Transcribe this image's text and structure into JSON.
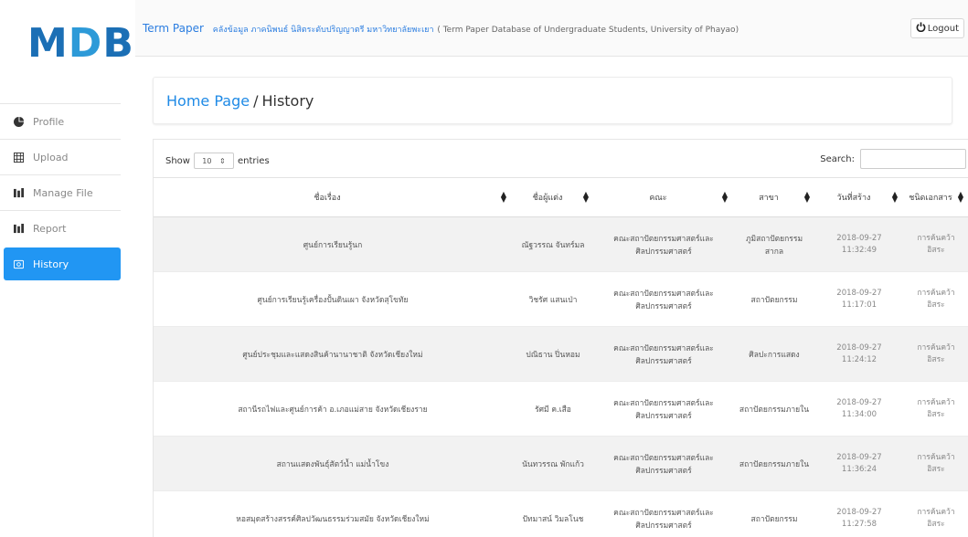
{
  "logo": {
    "left": "M",
    "mid": "D",
    "right": "B"
  },
  "sidebar": {
    "items": [
      {
        "label": "Profile",
        "icon": "pie-chart-icon"
      },
      {
        "label": "Upload",
        "icon": "table-icon"
      },
      {
        "label": "Manage File",
        "icon": "bars-icon"
      },
      {
        "label": "Report",
        "icon": "bars-icon"
      },
      {
        "label": "History",
        "icon": "history-icon"
      }
    ]
  },
  "topbar": {
    "brand": "Term Paper",
    "thai_title": "คลังข้อมูล ภาคนิพนธ์ นิสิตระดับปริญญาตรี มหาวิทยาลัยพะเยา",
    "eng_title": "( Term Paper Database of Undergraduate Students, University of Phayao)",
    "logout_label": "Logout"
  },
  "breadcrumb": {
    "home": "Home Page",
    "separator": "/",
    "current": "History"
  },
  "table_controls": {
    "show_label": "Show",
    "entries_value": "10",
    "entries_label": "entries",
    "search_label": "Search:"
  },
  "table": {
    "headers": [
      "ชื่อเรื่อง",
      "ชื่อผู้แต่ง",
      "คณะ",
      "สาขา",
      "วันที่สร้าง",
      "ชนิดเอกสาร"
    ],
    "rows": [
      {
        "title": "ศูนย์การเรียนรู้นก",
        "author": "ณัฐวรรณ จันทร์มล",
        "faculty": "คณะสถาปัตยกรรมศาสตร์และศิลปกรรมศาสตร์",
        "branch": "ภูมิสถาปัตยกรรมสากล",
        "date": "2018-09-27",
        "time": "11:32:49",
        "type1": "การค้นคว้า",
        "type2": "อิสระ"
      },
      {
        "title": "ศูนย์การเรียนรู้เครื่องปั้นดินเผา จังหวัดสุโขทัย",
        "author": "วิชรัศ แสนเป่า",
        "faculty": "คณะสถาปัตยกรรมศาสตร์และศิลปกรรมศาสตร์",
        "branch": "สถาปัตยกรรม",
        "date": "2018-09-27",
        "time": "11:17:01",
        "type1": "การค้นคว้า",
        "type2": "อิสระ"
      },
      {
        "title": "ศูนย์ประชุมและแสดงสินค้านานาชาติ จังหวัดเชียงใหม่",
        "author": "ปณิธาน ปิ่นหอม",
        "faculty": "คณะสถาปัตยกรรมศาสตร์และศิลปกรรมศาสตร์",
        "branch": "ศิลปะการแสดง",
        "date": "2018-09-27",
        "time": "11:24:12",
        "type1": "การค้นคว้า",
        "type2": "อิสระ"
      },
      {
        "title": "สถานีรถไฟและศูนย์การค้า อ.เภอแม่สาย จังหวัดเชียงราย",
        "author": "รัศมี ค.เสือ",
        "faculty": "คณะสถาปัตยกรรมศาสตร์และศิลปกรรมศาสตร์",
        "branch": "สถาปัตยกรรมภายใน",
        "date": "2018-09-27",
        "time": "11:34:00",
        "type1": "การค้นคว้า",
        "type2": "อิสระ"
      },
      {
        "title": "สถานแสดงพันธุ์สัตว์น้ำ แม่น้ำโขง",
        "author": "นันทวรรณ พักแก้ว",
        "faculty": "คณะสถาปัตยกรรมศาสตร์และศิลปกรรมศาสตร์",
        "branch": "สถาปัตยกรรมภายใน",
        "date": "2018-09-27",
        "time": "11:36:24",
        "type1": "การค้นคว้า",
        "type2": "อิสระ"
      },
      {
        "title": "หอสมุดสร้างสรรค์ศิลปวัฒนธรรมร่วมสมัย จังหวัดเชียงใหม่",
        "author": "ปัทมาสน์ วิมลโนช",
        "faculty": "คณะสถาปัตยกรรมศาสตร์และศิลปกรรมศาสตร์",
        "branch": "สถาปัตยกรรม",
        "date": "2018-09-27",
        "time": "11:27:58",
        "type1": "การค้นคว้า",
        "type2": "อิสระ"
      }
    ]
  },
  "colors": {
    "accent": "#2196f3",
    "logo": "#1b6fb5",
    "link": "#1f8ae6"
  }
}
